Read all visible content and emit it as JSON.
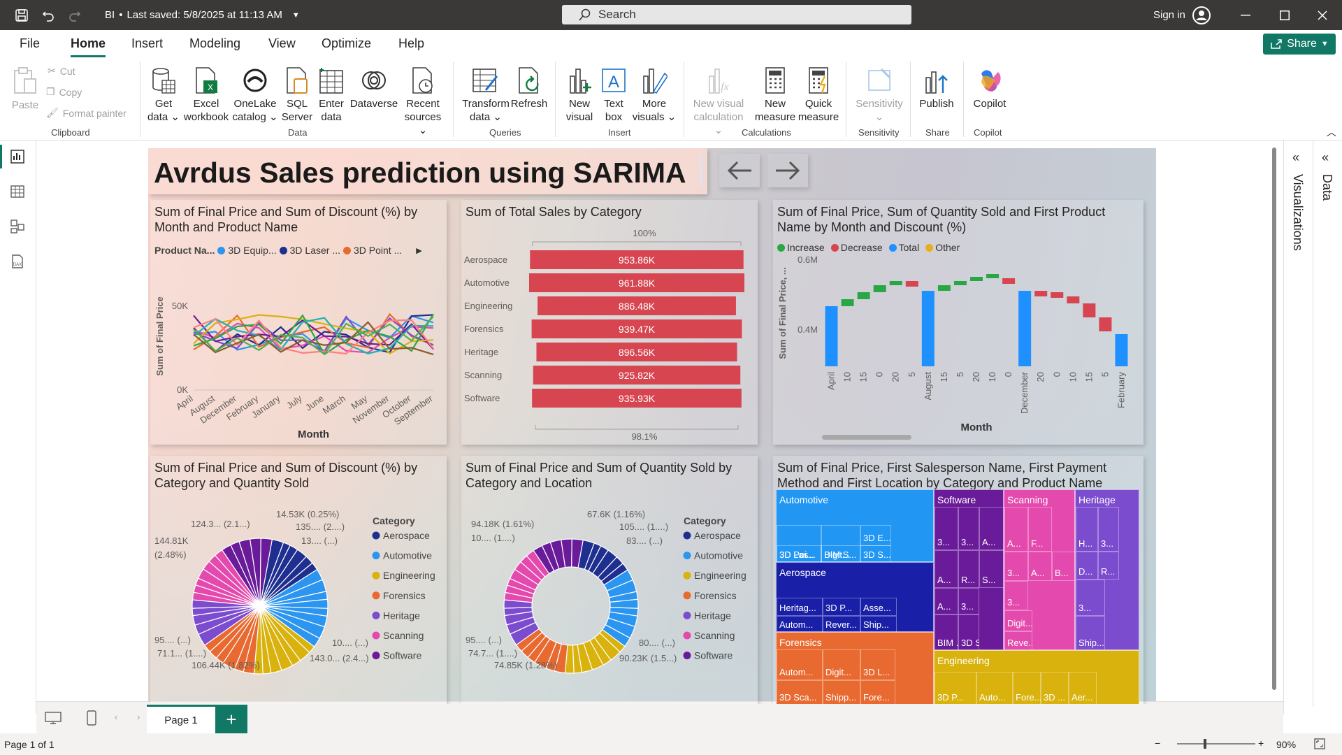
{
  "titlebar": {
    "file_name": "BI",
    "last_saved": "Last saved: 5/8/2025 at 11:13 AM",
    "search_placeholder": "Search",
    "sign_in": "Sign in"
  },
  "menu": {
    "tabs": [
      "File",
      "Home",
      "Insert",
      "Modeling",
      "View",
      "Optimize",
      "Help"
    ],
    "share": "Share"
  },
  "ribbon": {
    "paste": "Paste",
    "cut": "Cut",
    "copy": "Copy",
    "format_painter": "Format painter",
    "get_data": [
      "Get",
      "data"
    ],
    "excel": [
      "Excel",
      "workbook"
    ],
    "onelake": [
      "OneLake",
      "catalog"
    ],
    "sql": [
      "SQL",
      "Server"
    ],
    "enter_data": [
      "Enter",
      "data"
    ],
    "dataverse": "Dataverse",
    "recent": [
      "Recent",
      "sources"
    ],
    "transform": [
      "Transform",
      "data"
    ],
    "refresh": "Refresh",
    "new_visual": [
      "New",
      "visual"
    ],
    "text_box": [
      "Text",
      "box"
    ],
    "more_visuals": [
      "More",
      "visuals"
    ],
    "new_visual_calc": [
      "New visual",
      "calculation"
    ],
    "new_measure": [
      "New",
      "measure"
    ],
    "quick_measure": [
      "Quick",
      "measure"
    ],
    "sensitivity": "Sensitivity",
    "publish": "Publish",
    "copilot": "Copilot",
    "groups": [
      "Clipboard",
      "Data",
      "Queries",
      "Insert",
      "Calculations",
      "Sensitivity",
      "Share",
      "Copilot"
    ]
  },
  "report": {
    "title": "Avrdus Sales prediction using SARIMA",
    "c1_title": "Sum of Final Price and Sum of Discount (%) by Month and Product Name",
    "c1_legend_label": "Product Na...",
    "c1_legend": [
      "3D Equip...",
      "3D Laser ...",
      "3D Point ..."
    ],
    "c1_ylabel": "Sum of Final Price",
    "c1_xlabel": "Month",
    "c2_title": "Sum of Total Sales by Category",
    "c2_top": "100%",
    "c2_bottom": "98.1%",
    "c3_title": "Sum of Final Price, Sum of Quantity Sold and First Product Name by Month and Discount (%)",
    "c3_legend": [
      "Increase",
      "Decrease",
      "Total",
      "Other"
    ],
    "c3_ylabel": "Sum of Final Price, ...",
    "c3_xlabel": "Month",
    "c4_title": "Sum of Final Price and Sum of Discount (%) by Category and Quantity Sold",
    "c5_title": "Sum of Final Price and Sum of Quantity Sold by Category and Location",
    "c6_title": "Sum of Final Price, First Salesperson Name, First Payment Method and First Location by Category and Product Name",
    "category_legend_title": "Category",
    "categories": [
      "Aerospace",
      "Automotive",
      "Engineering",
      "Forensics",
      "Heritage",
      "Scanning",
      "Software"
    ],
    "c4_labels": [
      "124.3... (2.1...)",
      "14.53K (0.25%)",
      "135.... (2....)",
      "13.... (...)",
      "144.81K",
      "(2.48%)",
      "95.... (...)",
      "71.1... (1....)",
      "106.44K (1.82%)",
      "10.... (...)",
      "143.0... (2.4...)"
    ],
    "c5_labels": [
      "94.18K (1.61%)",
      "10.... (1....)",
      "67.6K (1.16%)",
      "105.... (1....)",
      "83.... (...)",
      "95.... (...)",
      "74.7... (1....)",
      "74.85K (1.28%)",
      "80.... (...)",
      "90.23K (1.5...)"
    ],
    "treemap": {
      "groups": [
        "Automotive",
        "Aerospace",
        "Forensics",
        "Software",
        "Scanning",
        "Heritage",
        "Engineering"
      ],
      "cells": [
        "3D Las...",
        "BIM S...",
        "3D E...",
        "3D Poi...",
        "Digit...",
        "3D S...",
        "Heritag...",
        "3D P...",
        "Asse...",
        "Autom...",
        "Rever...",
        "Ship...",
        "Autom...",
        "Digit...",
        "3D L...",
        "3D Sca...",
        "Shipp...",
        "Fore...",
        "3...",
        "3...",
        "A...",
        "A...",
        "R...",
        "S...",
        "A...",
        "3...",
        "BIM ...",
        "3D S...",
        "A...",
        "F...",
        "3...",
        "A...",
        "B...",
        "3...",
        "Digit...",
        "Reve...",
        "H...",
        "3...",
        "D...",
        "R...",
        "3...",
        "Ship...",
        "3D P...",
        "Auto...",
        "Fore...",
        "3D ...",
        "Aer...",
        "3D ..."
      ]
    }
  },
  "chart_data": [
    {
      "type": "line",
      "title": "Sum of Final Price and Sum of Discount (%) by Month and Product Name",
      "xlabel": "Month",
      "ylabel": "Sum of Final Price",
      "x": [
        "April",
        "August",
        "December",
        "February",
        "January",
        "July",
        "June",
        "March",
        "May",
        "November",
        "October",
        "September"
      ],
      "yticks": [
        "0K",
        "50K"
      ],
      "ylim": [
        0,
        75000
      ]
    },
    {
      "type": "bar",
      "title": "Sum of Total Sales by Category",
      "categories": [
        "Aerospace",
        "Automotive",
        "Engineering",
        "Forensics",
        "Heritage",
        "Scanning",
        "Software"
      ],
      "values": [
        953.86,
        961.88,
        886.48,
        939.47,
        896.56,
        925.82,
        935.93
      ],
      "value_labels": [
        "953.86K",
        "961.88K",
        "886.48K",
        "939.47K",
        "896.56K",
        "925.82K",
        "935.93K"
      ],
      "colors": [
        "#d64550"
      ]
    },
    {
      "type": "bar",
      "subtype": "waterfall",
      "title": "Sum of Final Price, Sum of Quantity Sold and First Product Name by Month and Discount (%)",
      "xlabel": "Month",
      "yticks": [
        "0.4M",
        "0.6M"
      ],
      "x": [
        "April",
        "10",
        "15",
        "0",
        "20",
        "5",
        "August",
        "15",
        "5",
        "20",
        "10",
        "0",
        "December",
        "20",
        "0",
        "10",
        "15",
        "5",
        "February"
      ],
      "kinds": [
        "total",
        "inc",
        "inc",
        "inc",
        "inc",
        "dec",
        "total",
        "inc",
        "inc",
        "inc",
        "inc",
        "dec",
        "total",
        "dec",
        "dec",
        "dec",
        "dec",
        "dec",
        "total"
      ]
    },
    {
      "type": "pie",
      "title": "Sum of Final Price and Sum of Discount (%) by Category and Quantity Sold",
      "categories": [
        "Aerospace",
        "Automotive",
        "Engineering",
        "Forensics",
        "Heritage",
        "Scanning",
        "Software"
      ],
      "colors": [
        "#1f2f8f",
        "#2b95f0",
        "#d9b20d",
        "#e86a30",
        "#7c4ccf",
        "#e449ad",
        "#6a1b9a"
      ]
    },
    {
      "type": "pie",
      "subtype": "donut",
      "title": "Sum of Final Price and Sum of Quantity Sold by Category and Location",
      "categories": [
        "Aerospace",
        "Automotive",
        "Engineering",
        "Forensics",
        "Heritage",
        "Scanning",
        "Software"
      ],
      "colors": [
        "#1f2f8f",
        "#2b95f0",
        "#d9b20d",
        "#e86a30",
        "#7c4ccf",
        "#e449ad",
        "#6a1b9a"
      ]
    }
  ],
  "pages": {
    "current": "Page 1"
  },
  "status": {
    "page_of": "Page 1 of 1",
    "zoom": "90%"
  },
  "panes": {
    "visualizations": "Visualizations",
    "data": "Data"
  },
  "colors": {
    "accent": "#117865",
    "bar": "#d64550",
    "increase": "#27a844",
    "decrease": "#d64550",
    "total": "#1e90ff",
    "other": "#e5b01a"
  }
}
